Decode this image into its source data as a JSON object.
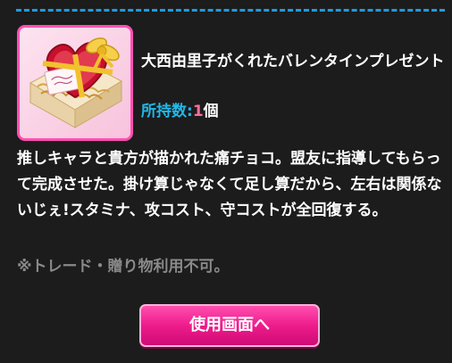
{
  "item": {
    "name": "大西由里子がくれたバレンタインプレゼント",
    "image_icon": "valentine-gift-box-icon",
    "owned_label": "所持数:",
    "owned_count": "1",
    "owned_unit": "個"
  },
  "description": "推しキャラと貴方が描かれた痛チョコ。盟友に指導してもらって完成させた。掛け算じゃなくて足し算だから、左右は関係ないじぇ!スタミナ、攻コスト、守コストが全回復する。",
  "note": "※トレード・贈り物利用不可。",
  "actions": {
    "use_label": "使用画面へ"
  },
  "colors": {
    "background": "#1c1c1c",
    "divider": "#1e9be0",
    "owned_label": "#22b8e8",
    "owned_count": "#ff6b9a",
    "note": "#8a8a8a",
    "button": "#ee1c8c",
    "thumb_border": "#ff4fb2"
  }
}
